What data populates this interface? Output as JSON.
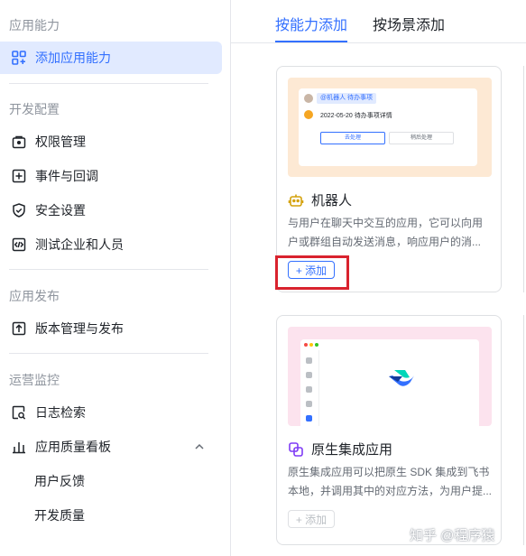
{
  "sidebar": {
    "sections": [
      {
        "title": "应用能力"
      },
      {
        "title": "开发配置"
      },
      {
        "title": "应用发布"
      },
      {
        "title": "运营监控"
      }
    ],
    "items": [
      {
        "label": "添加应用能力",
        "icon": "grid-plus-icon",
        "active": true
      },
      {
        "label": "权限管理",
        "icon": "lock-box-icon"
      },
      {
        "label": "事件与回调",
        "icon": "plus-square-icon"
      },
      {
        "label": "安全设置",
        "icon": "shield-check-icon"
      },
      {
        "label": "测试企业和人员",
        "icon": "code-box-icon"
      },
      {
        "label": "版本管理与发布",
        "icon": "upload-box-icon"
      },
      {
        "label": "日志检索",
        "icon": "log-search-icon"
      },
      {
        "label": "应用质量看板",
        "icon": "bar-chart-icon"
      },
      {
        "label": "用户反馈"
      },
      {
        "label": "开发质量"
      }
    ]
  },
  "tabs": [
    {
      "label": "按能力添加",
      "active": true
    },
    {
      "label": "按场景添加"
    }
  ],
  "cards": [
    {
      "title": "机器人",
      "icon": "robot-icon",
      "description": "与用户在聊天中交互的应用，它可以向用户或群组自动发送消息，响应用户的消...",
      "add_label": "+ 添加",
      "preview": {
        "chip": "@机器人 待办事项",
        "line": "2022-05-20 待办事项详情",
        "btn1": "去处理",
        "btn2": "稍后处理"
      }
    },
    {
      "title": "原生集成应用",
      "icon": "native-app-icon",
      "description": "原生集成应用可以把原生 SDK 集成到飞书本地，并调用其中的对应方法，为用户提...",
      "add_label": "+ 添加"
    }
  ],
  "watermark": "知乎 @程序猿",
  "colors": {
    "accent": "#3370ff",
    "highlight": "#d9232e"
  }
}
